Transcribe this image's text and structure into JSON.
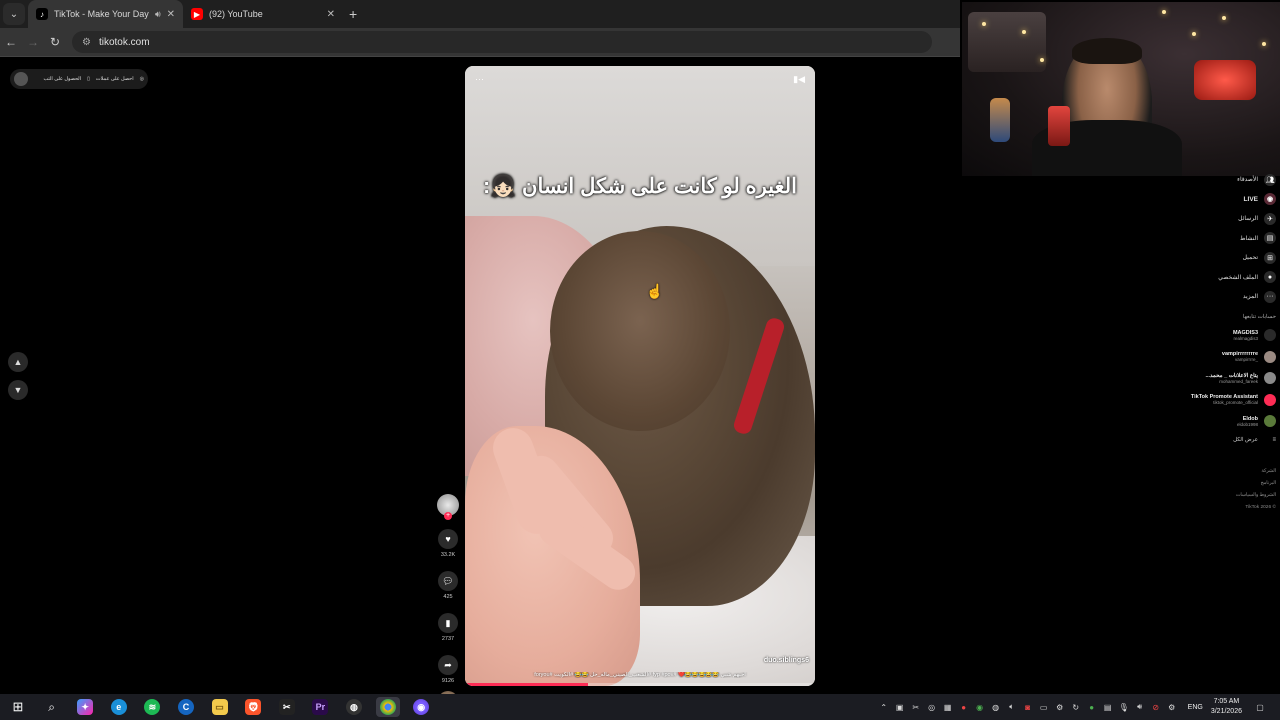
{
  "browser": {
    "tabs": [
      {
        "title": "TikTok - Make Your Day",
        "active": true,
        "muted_icon": "speaker-icon"
      },
      {
        "title": "(92) YouTube",
        "active": false
      }
    ],
    "url": "tikotok.com"
  },
  "top_pill": {
    "item1": "احصل على عملات",
    "item2": "الحصول على التب"
  },
  "video": {
    "overlay_text": "الغيره لو كانت على شكل انسان 👧🏻:",
    "username": "duo.siblings6",
    "caption": "احبهم شبي 😂😂😂😂😂❤️ #fyp #pov #الشعب_الصيني_ماله_حل 😂😂 #الكويت #foryou",
    "progress": 0.35
  },
  "actions": {
    "likes": "33.2K",
    "comments": "425",
    "saves": "2737",
    "shares": "9126"
  },
  "sidebar": {
    "items": [
      {
        "label": "الأصدقاء",
        "icon": "friends-icon"
      },
      {
        "label": "LIVE",
        "icon": "live-icon"
      },
      {
        "label": "الرسائل",
        "icon": "messages-icon"
      },
      {
        "label": "النشاط",
        "icon": "activity-icon"
      },
      {
        "label": "تحميل",
        "icon": "upload-icon"
      },
      {
        "label": "الملف الشخصي",
        "icon": "profile-icon"
      },
      {
        "label": "المزيد",
        "icon": "more-icon"
      }
    ],
    "following_heading": "حسابات تتابعها",
    "accounts": [
      {
        "name": "MAGDIS3",
        "handle": "realmagdis3",
        "color": "#2a2a2a"
      },
      {
        "name": "vampirrrrrrrre",
        "handle": "_vampirrrre",
        "color": "#9a8a82"
      },
      {
        "name": "يتاع الاعلانات _ محمد...",
        "handle": "mohammed_fareek",
        "color": "#8a8a8a"
      },
      {
        "name": "TikTok Promote Assistant",
        "handle": "tiktok_promote_official",
        "color": "#fe2c55"
      },
      {
        "name": "Eldob",
        "handle": "eldob1998",
        "color": "#5a7a3a"
      }
    ],
    "see_all": "عرض الكل",
    "footer": [
      "الشركة",
      "البرنامج",
      "الشروط والسياسات",
      "© 2026 TikTok"
    ]
  },
  "taskbar": {
    "language": "ENG",
    "time": "7:05 AM",
    "date": "3/21/2026"
  }
}
